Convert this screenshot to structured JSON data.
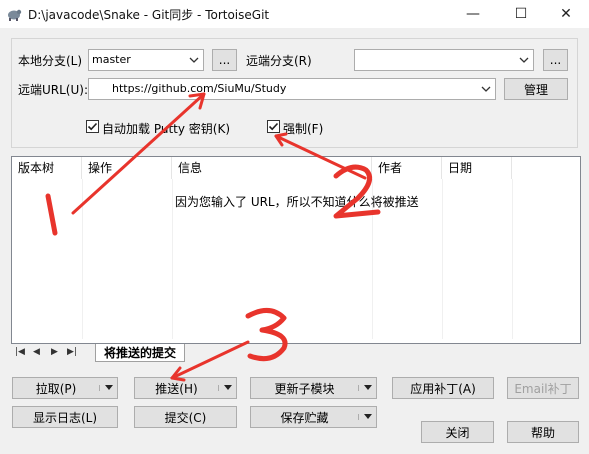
{
  "window": {
    "title": "D:\\javacode\\Snake - Git同步 - TortoiseGit",
    "minimize_glyph": "—",
    "maximize_glyph": "☐",
    "close_glyph": "✕"
  },
  "branch": {
    "local_label": "本地分支(L)",
    "local_value": "master",
    "local_browse": "...",
    "remote_label": "远端分支(R)",
    "remote_value": "",
    "remote_browse": "..."
  },
  "remote_url": {
    "label": "远端URL(U):",
    "value": "https://github.com/SiuMu/Study",
    "manage_label": "管理"
  },
  "options": {
    "autoload_putty_label": "自动加载 Putty 密钥(K)",
    "autoload_putty_checked": true,
    "force_label": "强制(F)",
    "force_checked": true
  },
  "list": {
    "columns": [
      "版本树",
      "操作",
      "信息",
      "作者",
      "日期"
    ],
    "message": "因为您输入了 URL，所以不知道什么将被推送"
  },
  "tabs": {
    "active": "将推送的提交"
  },
  "buttons": {
    "pull": "拉取(P)",
    "push": "推送(H)",
    "update_submodule": "更新子模块",
    "apply_patch": "应用补丁(A)",
    "email_patch": "Email补丁",
    "show_log": "显示日志(L)",
    "commit": "提交(C)",
    "stash_save": "保存贮藏",
    "close": "关闭",
    "help": "帮助"
  },
  "annotations": {
    "mark_1": "1",
    "mark_2": "2",
    "mark_3": "3",
    "color": "#e8342c"
  }
}
